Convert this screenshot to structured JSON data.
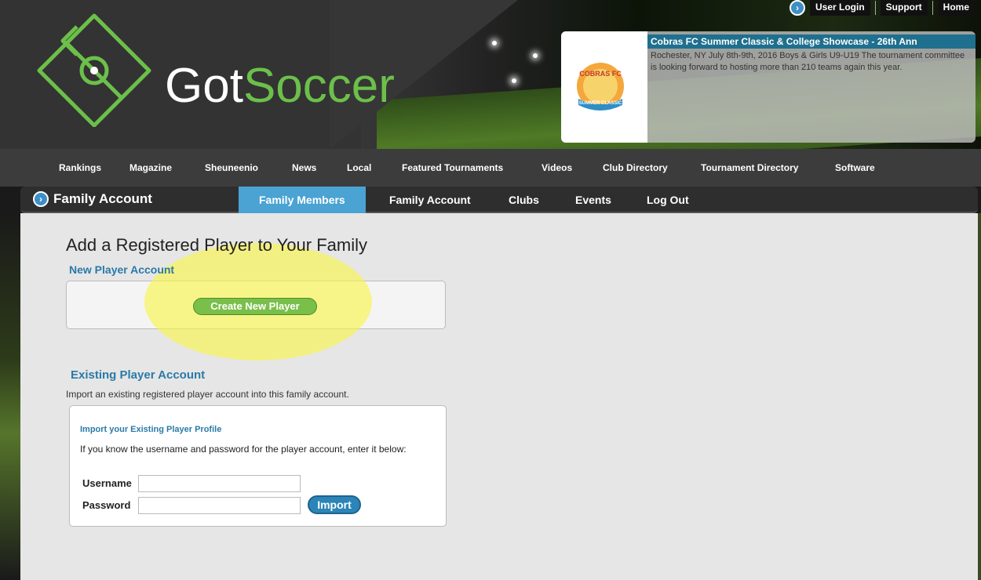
{
  "brand": {
    "logo_text_got": "Got",
    "logo_text_soccer": "Soccer"
  },
  "top_links": [
    "User Login",
    "Support",
    "Home"
  ],
  "promo": {
    "title": "Cobras FC Summer Classic & College Showcase - 26th Ann",
    "text": "Rochester, NY July 8th-9th, 2016 Boys & Girls U9-U19 The tournament committee is looking forward to hosting more than 210 teams again this year.",
    "logo_line1": "COBRAS FC",
    "logo_line2": "SUMMER CLASSIC"
  },
  "main_nav": [
    "Rankings",
    "Magazine",
    "Sheuneenio",
    "News",
    "Local",
    "Featured Tournaments",
    "Videos",
    "Club Directory",
    "Tournament Directory",
    "Software"
  ],
  "sub_nav": {
    "section_title": "Family Account",
    "tabs": [
      "Family Members",
      "Family Account",
      "Clubs",
      "Events",
      "Log Out"
    ],
    "active_tab": "Family Members"
  },
  "content": {
    "page_title": "Add a Registered Player to Your Family",
    "new_player_heading": "New Player Account",
    "create_button": "Create New Player",
    "existing_heading": "Existing Player Account",
    "existing_desc": "Import an existing registered player account into this family account.",
    "import_heading": "Import your Existing Player Profile",
    "import_desc": "If you know the username and password for the player account, enter it below:",
    "username_label": "Username",
    "password_label": "Password",
    "username_value": "",
    "password_value": "",
    "import_button": "Import"
  },
  "colors": {
    "accent_blue": "#4aa3d3",
    "brand_green": "#6cc04a",
    "highlight_yellow": "#faf546"
  }
}
